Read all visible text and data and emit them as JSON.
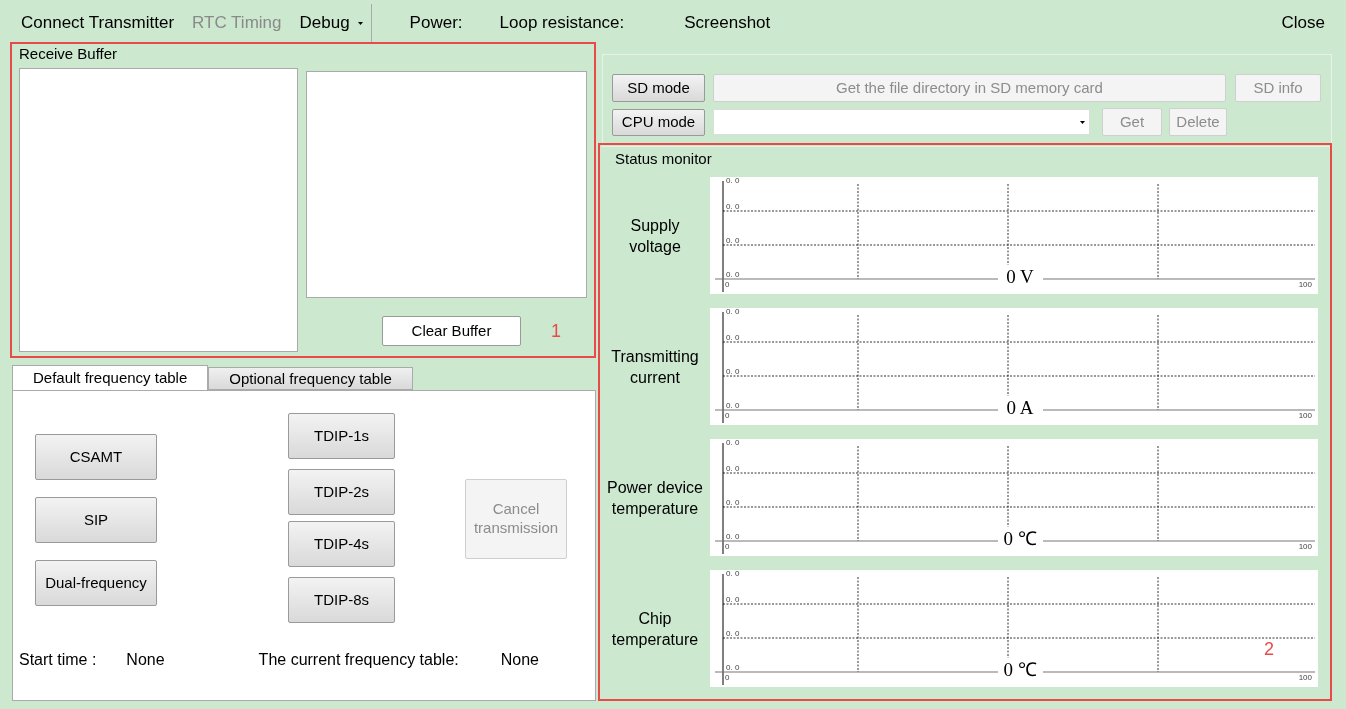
{
  "menu_bar": {
    "items": [
      {
        "label": "Connect Transmitter",
        "disabled": false,
        "dropdown": false
      },
      {
        "label": "RTC Timing",
        "disabled": true,
        "dropdown": false
      },
      {
        "label": "Debug",
        "disabled": false,
        "dropdown": true
      }
    ],
    "status": [
      "Power:",
      "Loop resistance:"
    ],
    "screenshot": "Screenshot",
    "close": "Close"
  },
  "receive_buffer": {
    "title": "Receive Buffer",
    "clear_button": "Clear Buffer",
    "annotation": "1"
  },
  "frequency_tabs": [
    {
      "label": "Default frequency table",
      "selected": true
    },
    {
      "label": "Optional frequency table",
      "selected": false
    }
  ],
  "frequency_buttons": {
    "column_1": [
      "CSAMT",
      "SIP",
      "Dual-frequency"
    ],
    "column_2": [
      "TDIP-1s",
      "TDIP-2s",
      "TDIP-4s",
      "TDIP-8s"
    ]
  },
  "cancel_button": {
    "label": "Cancel transmission",
    "disabled": true
  },
  "footer": [
    {
      "label": "Start time :",
      "value": "None"
    },
    {
      "label": "The current frequency table:",
      "value": "None"
    }
  ],
  "sd_card": {
    "sd_mode_button": {
      "label": "SD mode",
      "disabled": false
    },
    "directory_button": {
      "label": "Get the file directory in SD memory card",
      "disabled": true
    },
    "sd_info_button": {
      "label": "SD info",
      "disabled": true
    },
    "cpu_mode_button": {
      "label": "CPU mode",
      "disabled": false
    },
    "get_button": {
      "label": "Get",
      "disabled": true
    },
    "delete_button": {
      "label": "Delete",
      "disabled": true
    }
  },
  "status_monitor": {
    "title": "Status monitor",
    "annotation": "2",
    "monitors": [
      {
        "label": "Supply voltage",
        "reading": "0 V",
        "y_ticks": [
          "0. 0",
          "0. 0",
          "0. 0",
          "0. 0"
        ],
        "x_ticks": [
          "0",
          "100"
        ]
      },
      {
        "label": "Transmitting current",
        "reading": "0 A",
        "y_ticks": [
          "0. 0",
          "0. 0",
          "0. 0",
          "0. 0"
        ],
        "x_ticks": [
          "0",
          "100"
        ]
      },
      {
        "label": "Power device temperature",
        "reading": "0 ℃",
        "y_ticks": [
          "0. 0",
          "0. 0",
          "0. 0",
          "0. 0"
        ],
        "x_ticks": [
          "0",
          "100"
        ]
      },
      {
        "label": "Chip temperature",
        "reading": "0 ℃",
        "y_ticks": [
          "0. 0",
          "0. 0",
          "0. 0",
          "0. 0"
        ],
        "x_ticks": [
          "0",
          "100"
        ]
      }
    ]
  }
}
